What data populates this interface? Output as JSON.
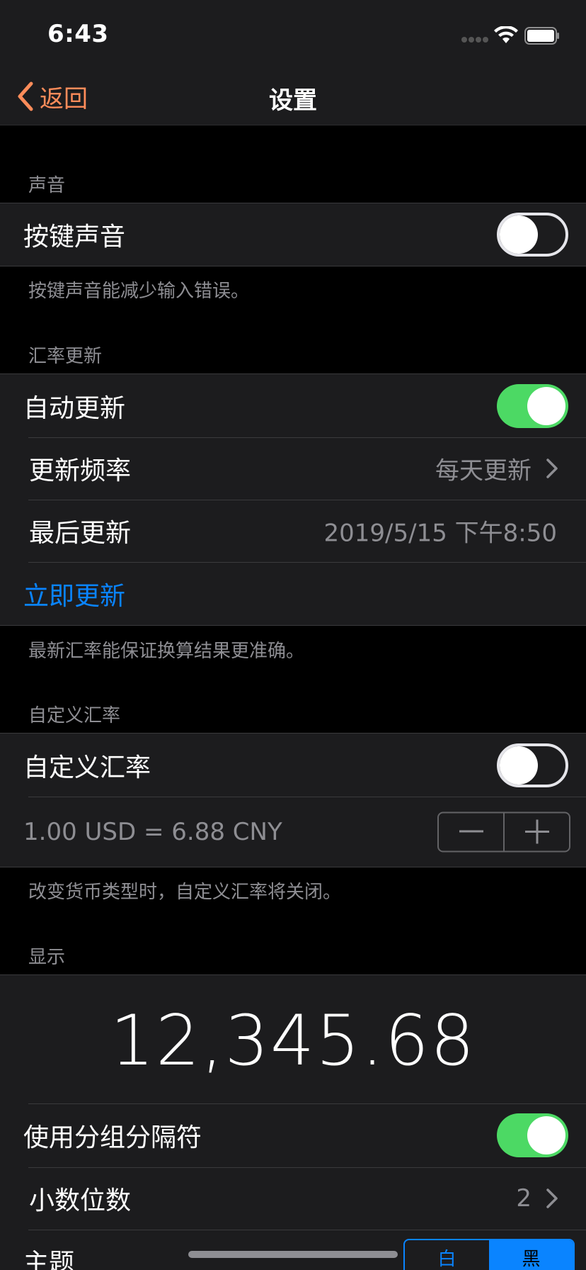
{
  "status_bar": {
    "time": "6:43"
  },
  "nav": {
    "back_label": "返回",
    "title": "设置"
  },
  "sound": {
    "header": "声音",
    "key_sound_label": "按键声音",
    "key_sound_on": false,
    "footer": "按键声音能减少输入错误。"
  },
  "rate_update": {
    "header": "汇率更新",
    "auto_update_label": "自动更新",
    "auto_update_on": true,
    "frequency_label": "更新频率",
    "frequency_value": "每天更新",
    "last_update_label": "最后更新",
    "last_update_value": "2019/5/15 下午8:50",
    "update_now_label": "立即更新",
    "footer": "最新汇率能保证换算结果更准确。"
  },
  "custom_rate": {
    "header": "自定义汇率",
    "toggle_label": "自定义汇率",
    "toggle_on": false,
    "rate_text": "1.00 USD = 6.88 CNY",
    "footer": "改变货币类型时，自定义汇率将关闭。"
  },
  "display": {
    "header": "显示",
    "preview_number": "12,345.68",
    "grouping_label": "使用分组分隔符",
    "grouping_on": true,
    "decimals_label": "小数位数",
    "decimals_value": "2",
    "theme_label": "主题",
    "theme_options": [
      "白",
      "黑"
    ],
    "theme_selected": "黑"
  },
  "colors": {
    "accent_orange": "#ff8c5a",
    "link_blue": "#0a84ff",
    "toggle_green": "#4cd964"
  }
}
